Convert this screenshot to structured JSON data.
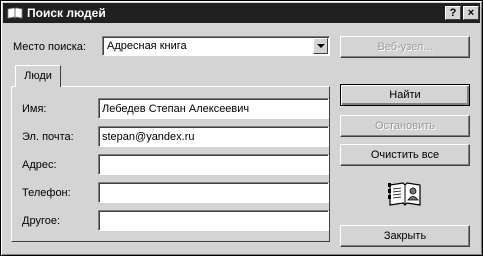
{
  "window": {
    "title": "Поиск людей",
    "help_symbol": "?",
    "close_symbol": "×",
    "icons": {
      "title": "address-book-icon",
      "help": "help-icon",
      "close": "close-icon",
      "illustration": "people-book-icon"
    }
  },
  "search_location": {
    "label": "Место поиска:",
    "value": "Адресная книга"
  },
  "tabs": [
    {
      "label": "Люди",
      "active": true
    }
  ],
  "fields": {
    "name": {
      "label": "Имя:",
      "value": "Лебедев Степан Алексеевич"
    },
    "email": {
      "label": "Эл. почта:",
      "value": "stepan@yandex.ru"
    },
    "address": {
      "label": "Адрес:",
      "value": ""
    },
    "phone": {
      "label": "Телефон:",
      "value": ""
    },
    "other": {
      "label": "Другое:",
      "value": ""
    }
  },
  "buttons": {
    "website": "Веб-узел...",
    "find": "Найти",
    "stop": "Остановить",
    "clear_all": "Очистить все",
    "close": "Закрыть"
  },
  "colors": {
    "titlebar": "#202020",
    "face": "#d4d4d4",
    "disabled_text": "#9a9a9a"
  }
}
